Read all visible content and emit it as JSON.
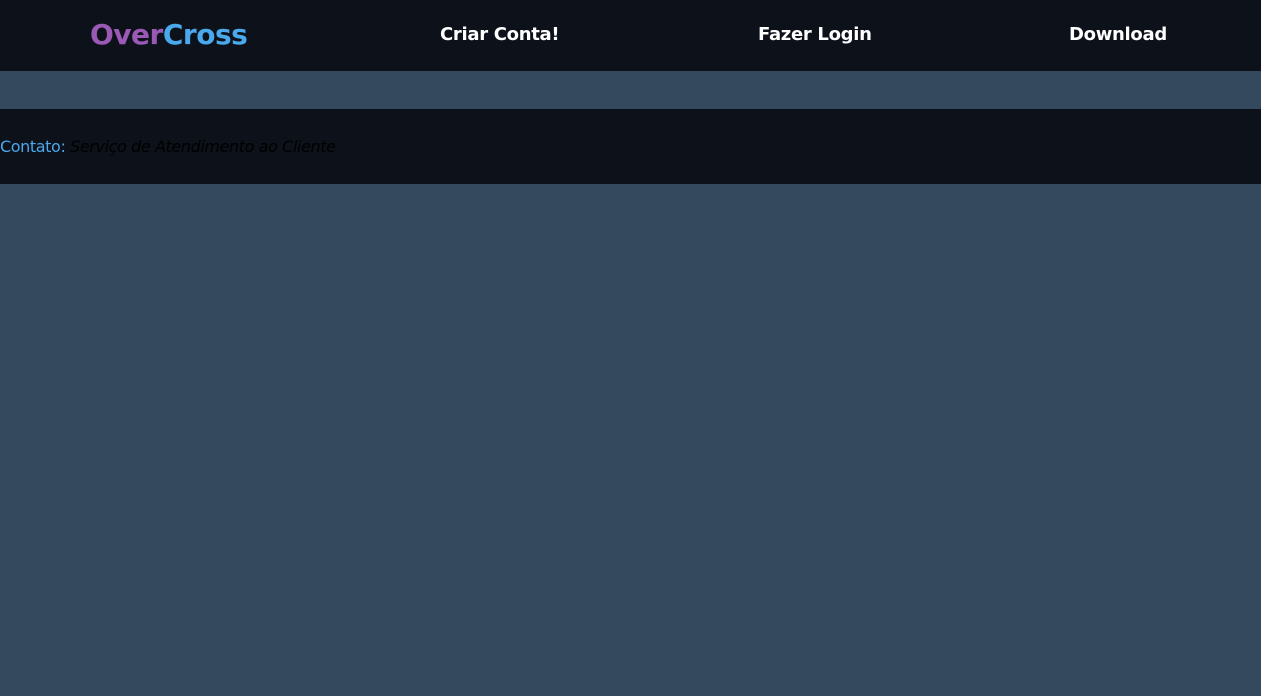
{
  "header": {
    "logo_part1": "Over",
    "logo_part2": "Cross",
    "nav": {
      "create_account": "Criar Conta!",
      "login": "Fazer Login",
      "download": "Download"
    }
  },
  "footer": {
    "contact_label": "Contato:",
    "contact_value": "Serviço de Atendimento ao Cliente"
  },
  "colors": {
    "background": "#34495e",
    "bar": "#0c111a",
    "logo_purple": "#9b59b6",
    "logo_blue": "#4aa8ec",
    "nav_text": "#ffffff"
  }
}
